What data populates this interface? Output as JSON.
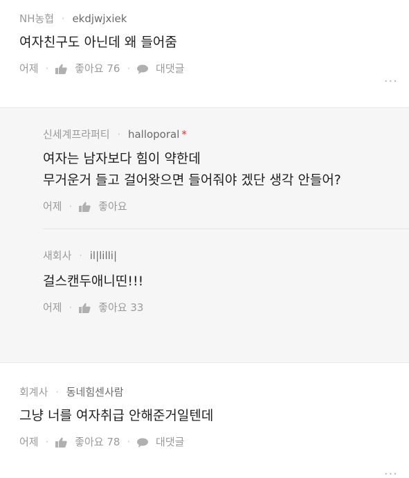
{
  "comments": [
    {
      "company": "NH농협",
      "nickname": "ekdjwjxiek",
      "text": "여자친구도 아닌데 왜 들어줌",
      "time": "어제",
      "like_label": "좋아요",
      "like_count": "76",
      "reply_label": "대댓글",
      "more": "..."
    }
  ],
  "replies": [
    {
      "company": "신세계프라퍼티",
      "nickname": "halloporal",
      "star": "*",
      "text_line1": "여자는 남자보다 힘이 약한데",
      "text_line2": "무거운거 들고 걸어왓으면 들어줘야 겠단 생각 안들어?",
      "time": "어제",
      "like_label": "좋아요"
    },
    {
      "company": "새회사",
      "nickname": "il|lilli|",
      "text": "걸스캔두애니띤!!!",
      "time": "어제",
      "like_label": "좋아요",
      "like_count": "33"
    }
  ],
  "bottom_comment": {
    "company": "회계사",
    "nickname": "동네힘센사람",
    "text": "그냥 너를 여자취급 안해준거일텐데",
    "time": "어제",
    "like_label": "좋아요",
    "like_count": "78",
    "reply_label": "대댓글",
    "more": "..."
  },
  "icons": {
    "like": "thumbs-up-icon",
    "reply": "speech-bubble-icon",
    "more": "more-dots-icon"
  },
  "colors": {
    "reply_background": "#f6f6f6",
    "star": "#ee3333"
  }
}
